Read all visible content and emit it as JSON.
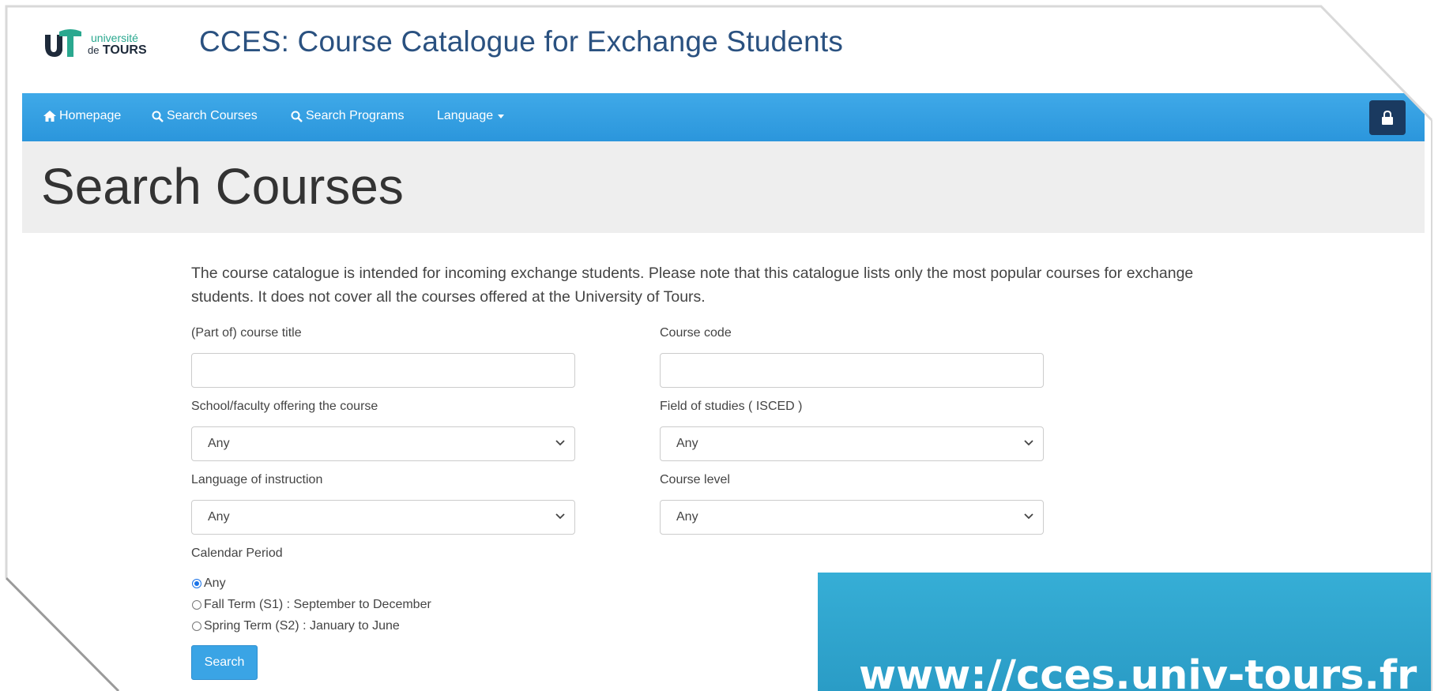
{
  "header": {
    "logo": {
      "line1": "université",
      "line2_prefix": "de",
      "line2": "TOURS"
    },
    "site_title": "CCES: Course Catalogue for Exchange Students"
  },
  "navbar": {
    "items": [
      {
        "label": "Homepage",
        "icon": "home-icon"
      },
      {
        "label": "Search Courses",
        "icon": "search-icon"
      },
      {
        "label": "Search Programs",
        "icon": "search-icon"
      },
      {
        "label": "Language",
        "icon": "caret-down-icon"
      }
    ],
    "login_icon": "lock-icon"
  },
  "page": {
    "title": "Search Courses",
    "intro": "The course catalogue is intended for incoming exchange students. Please note that this catalogue lists only the most popular courses for exchange students. It does not cover all the courses offered at the University of Tours."
  },
  "form": {
    "course_title_label": "(Part of) course title",
    "course_title_value": "",
    "course_code_label": "Course code",
    "course_code_value": "",
    "school_label": "School/faculty offering the course",
    "school_value": "Any",
    "field_label": "Field of studies ( ISCED )",
    "field_value": "Any",
    "language_label": "Language of instruction",
    "language_value": "Any",
    "level_label": "Course level",
    "level_value": "Any",
    "calendar_label": "Calendar Period",
    "calendar_options": [
      {
        "label": "Any",
        "checked": true
      },
      {
        "label": "Fall Term (S1) : September to December",
        "checked": false
      },
      {
        "label": "Spring Term (S2) : January to June",
        "checked": false
      }
    ],
    "search_button": "Search"
  },
  "banner": {
    "url": "www://cces.univ-tours.fr"
  },
  "colors": {
    "navbar": "#3fa9e8",
    "title": "#2a5180",
    "banner": "#36aed6",
    "lock_button": "#1a3a60"
  }
}
